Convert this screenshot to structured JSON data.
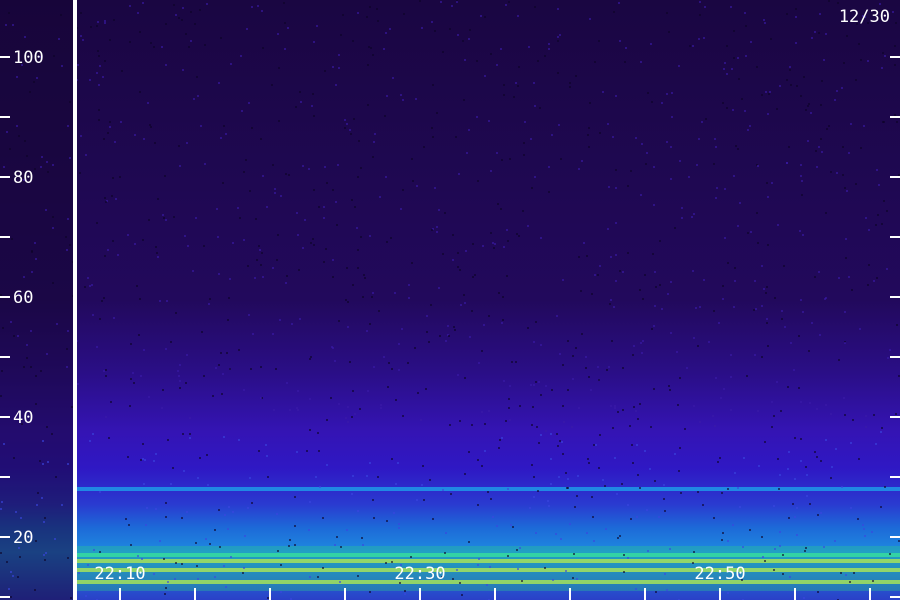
{
  "chart_data": {
    "type": "heatmap",
    "title": "",
    "date_label": "12/30",
    "xlabel": "",
    "ylabel": "",
    "x_time_range": [
      "22:06",
      "23:06"
    ],
    "y_range": [
      10,
      110
    ],
    "y_tick_values": [
      10,
      20,
      30,
      40,
      50,
      60,
      70,
      80,
      90,
      100
    ],
    "y_tick_labels": [
      "20",
      "40",
      "60",
      "80",
      "100"
    ],
    "y_tick_label_values": [
      20,
      40,
      60,
      80,
      100
    ],
    "x_tick_labels": [
      "22:10",
      "22:30",
      "22:50"
    ],
    "x_tick_label_values": [
      "22:10",
      "22:30",
      "22:50"
    ],
    "x_minor_tick_interval_minutes": 5,
    "gap_time": "22:07",
    "colors": {
      "background": "#1c0848",
      "low": "#3a12b0",
      "mid": "#1e88e8",
      "high": "#42f0a0",
      "peak": "#f0f040",
      "axis": "#ffffff"
    },
    "bands": [
      {
        "y": 28,
        "intensity": "mid"
      },
      {
        "y": 17,
        "intensity": "high"
      },
      {
        "y": 16,
        "intensity": "peak"
      },
      {
        "y": 14.5,
        "intensity": "peak"
      },
      {
        "y": 12.5,
        "intensity": "peak"
      }
    ]
  }
}
